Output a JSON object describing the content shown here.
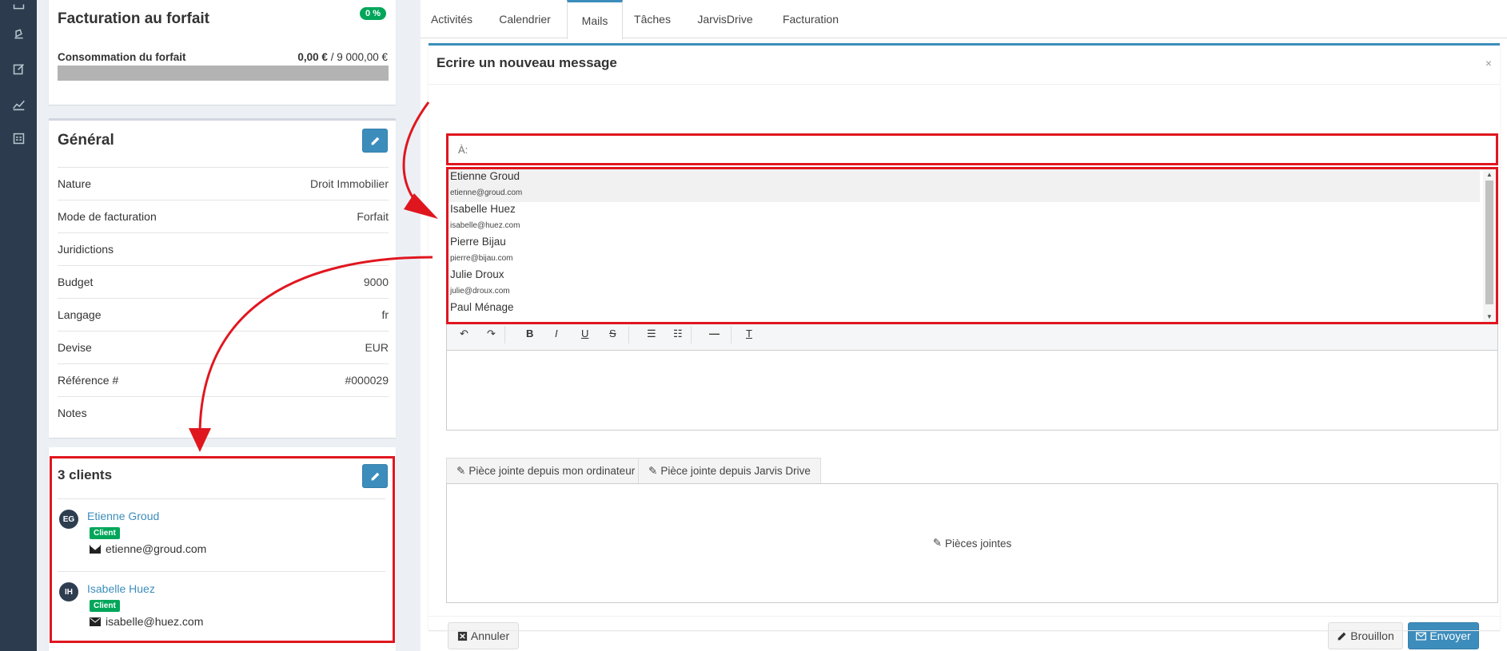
{
  "nav": {
    "icons": [
      "inbox-icon",
      "flag-icon",
      "edit-icon",
      "chart-icon",
      "calculator-icon"
    ]
  },
  "forfait": {
    "title": "Facturation au forfait",
    "percent": "0 %",
    "consumption_label": "Consommation du forfait",
    "consumed": "0,00 €",
    "total": "/ 9 000,00 €",
    "progress_fraction": 0
  },
  "general": {
    "title": "Général",
    "rows": [
      {
        "label": "Nature",
        "value": "Droit Immobilier"
      },
      {
        "label": "Mode de facturation",
        "value": "Forfait"
      },
      {
        "label": "Juridictions",
        "value": ""
      },
      {
        "label": "Budget",
        "value": "9000"
      },
      {
        "label": "Langage",
        "value": "fr"
      },
      {
        "label": "Devise",
        "value": "EUR"
      },
      {
        "label": "Référence #",
        "value": "#000029"
      },
      {
        "label": "Notes",
        "value": ""
      }
    ]
  },
  "clients": {
    "title": "3 clients",
    "items": [
      {
        "initials": "EG",
        "name": "Etienne Groud",
        "badge": "Client",
        "email": "etienne@groud.com"
      },
      {
        "initials": "IH",
        "name": "Isabelle Huez",
        "badge": "Client",
        "email": "isabelle@huez.com"
      }
    ]
  },
  "tabs": [
    "Activités",
    "Calendrier",
    "Mails",
    "Tâches",
    "JarvisDrive",
    "Facturation"
  ],
  "composer": {
    "title": "Ecrire un nouveau message",
    "close": "×",
    "to_placeholder": "À:",
    "suggestions": [
      {
        "name": "Etienne Groud",
        "email": "etienne@groud.com"
      },
      {
        "name": "Isabelle Huez",
        "email": "isabelle@huez.com"
      },
      {
        "name": "Pierre Bijau",
        "email": "pierre@bijau.com"
      },
      {
        "name": "Julie Droux",
        "email": "julie@droux.com"
      },
      {
        "name": "Paul Ménage",
        "email": ""
      }
    ],
    "toolbar": [
      "undo-icon",
      "redo-icon",
      "bold-icon",
      "italic-icon",
      "underline-icon",
      "strike-icon",
      "bullet-list-icon",
      "ordered-list-icon",
      "horizontal-rule-icon",
      "clear-format-icon"
    ],
    "attach_computer": "Pièce jointe depuis mon ordinateur",
    "attach_drive": "Pièce jointe depuis Jarvis Drive",
    "attachments": "Pièces jointes",
    "cancel": "Annuler",
    "draft": "Brouillon",
    "send": "Envoyer"
  },
  "colors": {
    "accent": "#3c8dbc",
    "success": "#00a65a",
    "highlight": "#e0161f",
    "nav": "#2c3b4d"
  }
}
